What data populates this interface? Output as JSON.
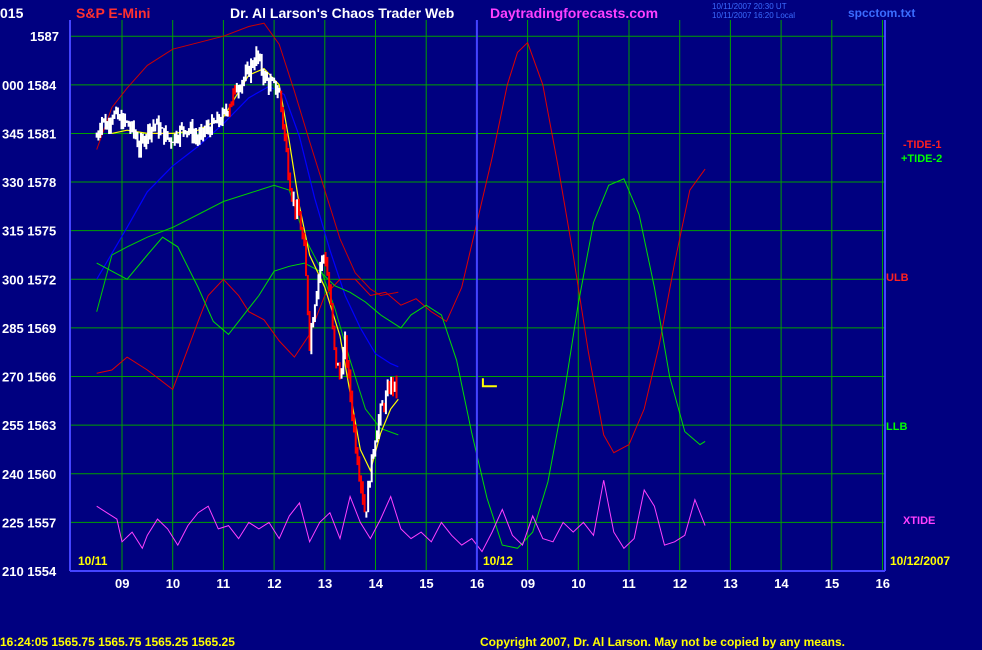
{
  "header": {
    "instrument": "S&P E-Mini",
    "title": "Dr. Al Larson's Chaos Trader Web",
    "site": "Daytradingforecasts.com",
    "stamp1": "10/11/2007 20:30 UT",
    "stamp2": "10/11/2007 16:20 Local",
    "file": "spcctom.txt"
  },
  "footer": {
    "quote": "16:24:05  1565.75  1565.75  1565.25  1565.25",
    "copyright": "Copyright 2007, Dr. Al Larson. May not be copied by any means."
  },
  "colors": {
    "background": "#000080",
    "grid": "#00a000",
    "price_bar": "#ffffff",
    "price_bar_down": "#ff0000",
    "tide1": "#e00000",
    "tide2": "#00dd00",
    "ulb": "#cc0000",
    "llb": "#00cc00",
    "xtide": "#ff40ff",
    "ma": "#ffff00",
    "ma_slow": "#0000ff",
    "now_line": "#4444ff"
  },
  "chart_data": {
    "type": "line",
    "title": "Dr. Al Larson's Chaos Trader Web",
    "y_left_labels": [
      "015",
      "000",
      "345",
      "330",
      "315",
      "300",
      "285",
      "270",
      "255",
      "240",
      "225",
      "210"
    ],
    "y_prices": [
      1587,
      1584,
      1581,
      1578,
      1575,
      1572,
      1569,
      1566,
      1563,
      1560,
      1557,
      1554
    ],
    "ylim": [
      1554,
      1588
    ],
    "x_hour_labels": [
      "09",
      "10",
      "11",
      "12",
      "13",
      "14",
      "15",
      "16",
      "09",
      "10",
      "11",
      "12",
      "13",
      "14",
      "15",
      "16"
    ],
    "x_date_labels": [
      "10/11",
      "10/12",
      "10/12/2007"
    ],
    "series_labels": [
      "-TIDE-1",
      "+TIDE-2",
      "ULB",
      "LLB",
      "XTIDE"
    ],
    "marker_label": "L",
    "price_close": [
      [
        0.0,
        1580.8
      ],
      [
        0.1,
        1582.0
      ],
      [
        0.2,
        1581.4
      ],
      [
        0.3,
        1582.3
      ],
      [
        0.45,
        1581.8
      ],
      [
        0.6,
        1581.6
      ],
      [
        0.75,
        1581.0
      ],
      [
        0.85,
        1580.0
      ],
      [
        0.95,
        1580.8
      ],
      [
        1.0,
        1581.2
      ],
      [
        1.15,
        1581.6
      ],
      [
        1.3,
        1581.0
      ],
      [
        1.45,
        1580.6
      ],
      [
        1.6,
        1581.0
      ],
      [
        1.75,
        1581.4
      ],
      [
        1.9,
        1581.0
      ],
      [
        2.0,
        1580.6
      ],
      [
        2.15,
        1581.2
      ],
      [
        2.3,
        1581.5
      ],
      [
        2.5,
        1582.0
      ],
      [
        2.7,
        1583.4
      ],
      [
        2.85,
        1584.3
      ],
      [
        2.95,
        1584.5
      ],
      [
        3.05,
        1585.2
      ],
      [
        3.15,
        1585.8
      ],
      [
        3.25,
        1585.0
      ],
      [
        3.35,
        1584.2
      ],
      [
        3.45,
        1584.0
      ],
      [
        3.6,
        1583.6
      ],
      [
        3.7,
        1581.0
      ],
      [
        3.8,
        1578.2
      ],
      [
        3.9,
        1576.5
      ],
      [
        4.0,
        1575.8
      ],
      [
        4.1,
        1573.6
      ],
      [
        4.15,
        1571.0
      ],
      [
        4.2,
        1568.2
      ],
      [
        4.3,
        1570.6
      ],
      [
        4.4,
        1572.8
      ],
      [
        4.5,
        1573.6
      ],
      [
        4.6,
        1571.0
      ],
      [
        4.7,
        1567.2
      ],
      [
        4.8,
        1566.0
      ],
      [
        4.9,
        1568.0
      ],
      [
        5.0,
        1565.0
      ],
      [
        5.1,
        1562.0
      ],
      [
        5.2,
        1559.8
      ],
      [
        5.3,
        1557.4
      ],
      [
        5.4,
        1560.2
      ],
      [
        5.5,
        1562.4
      ],
      [
        5.6,
        1563.8
      ],
      [
        5.7,
        1564.6
      ],
      [
        5.8,
        1565.6
      ],
      [
        5.9,
        1565.2
      ],
      [
        5.95,
        1565.4
      ]
    ],
    "ma_fast": [
      [
        0.3,
        1581.0
      ],
      [
        0.6,
        1581.2
      ],
      [
        1.0,
        1581.0
      ],
      [
        1.5,
        1581.0
      ],
      [
        2.0,
        1581.2
      ],
      [
        2.5,
        1582.0
      ],
      [
        3.0,
        1584.6
      ],
      [
        3.3,
        1585.0
      ],
      [
        3.6,
        1584.0
      ],
      [
        3.8,
        1580.5
      ],
      [
        4.0,
        1576.5
      ],
      [
        4.2,
        1573.5
      ],
      [
        4.5,
        1571.5
      ],
      [
        4.8,
        1568.5
      ],
      [
        5.0,
        1565.0
      ],
      [
        5.2,
        1561.5
      ],
      [
        5.4,
        1560.2
      ],
      [
        5.6,
        1562.5
      ],
      [
        5.8,
        1564.0
      ],
      [
        5.95,
        1564.6
      ]
    ],
    "ma_slow": [
      [
        0.0,
        1572.0
      ],
      [
        0.3,
        1573.6
      ],
      [
        0.6,
        1575.2
      ],
      [
        1.0,
        1577.4
      ],
      [
        1.5,
        1579.0
      ],
      [
        2.0,
        1580.2
      ],
      [
        2.5,
        1581.6
      ],
      [
        3.0,
        1583.2
      ],
      [
        3.4,
        1583.9
      ],
      [
        3.7,
        1583.4
      ],
      [
        4.0,
        1580.8
      ],
      [
        4.3,
        1577.0
      ],
      [
        4.6,
        1573.8
      ],
      [
        4.9,
        1571.0
      ],
      [
        5.2,
        1569.0
      ],
      [
        5.5,
        1567.4
      ],
      [
        5.8,
        1566.8
      ],
      [
        5.95,
        1566.6
      ]
    ],
    "llb": [
      [
        0.0,
        1570.0
      ],
      [
        0.3,
        1573.5
      ],
      [
        0.6,
        1574.0
      ],
      [
        1.0,
        1574.6
      ],
      [
        1.5,
        1575.2
      ],
      [
        2.0,
        1576.0
      ],
      [
        2.5,
        1576.8
      ],
      [
        3.0,
        1577.3
      ],
      [
        3.3,
        1577.6
      ],
      [
        3.5,
        1577.8
      ],
      [
        3.8,
        1577.5
      ],
      [
        4.1,
        1574.6
      ],
      [
        4.4,
        1572.8
      ],
      [
        4.7,
        1570.2
      ],
      [
        5.0,
        1567.0
      ],
      [
        5.3,
        1564.0
      ],
      [
        5.6,
        1562.8
      ],
      [
        5.95,
        1562.4
      ]
    ],
    "ulb": [
      [
        0.0,
        1580.0
      ],
      [
        0.3,
        1582.6
      ],
      [
        0.6,
        1583.8
      ],
      [
        1.0,
        1585.2
      ],
      [
        1.5,
        1586.2
      ],
      [
        2.0,
        1586.6
      ],
      [
        2.5,
        1587.0
      ],
      [
        3.0,
        1587.6
      ],
      [
        3.3,
        1587.8
      ],
      [
        3.6,
        1586.5
      ],
      [
        3.9,
        1583.6
      ],
      [
        4.2,
        1580.5
      ],
      [
        4.5,
        1577.5
      ],
      [
        4.8,
        1574.5
      ],
      [
        5.1,
        1572.4
      ],
      [
        5.4,
        1571.4
      ],
      [
        5.6,
        1571.0
      ],
      [
        5.95,
        1571.2
      ]
    ],
    "tide1": [
      [
        0.0,
        1566.2
      ],
      [
        0.3,
        1566.4
      ],
      [
        0.6,
        1567.2
      ],
      [
        1.0,
        1566.4
      ],
      [
        1.5,
        1565.2
      ],
      [
        2.0,
        1569.4
      ],
      [
        2.2,
        1571.0
      ],
      [
        2.5,
        1572.0
      ],
      [
        2.8,
        1571.0
      ],
      [
        3.0,
        1570.0
      ],
      [
        3.3,
        1569.5
      ],
      [
        3.6,
        1568.2
      ],
      [
        3.9,
        1567.2
      ],
      [
        4.2,
        1568.6
      ],
      [
        4.5,
        1571.0
      ],
      [
        4.8,
        1572.0
      ],
      [
        5.1,
        1572.0
      ],
      [
        5.4,
        1571.0
      ],
      [
        5.7,
        1571.2
      ],
      [
        6.0,
        1570.4
      ],
      [
        6.3,
        1570.8
      ],
      [
        6.6,
        1570.0
      ],
      [
        6.9,
        1569.4
      ],
      [
        7.2,
        1571.5
      ],
      [
        7.5,
        1575.5
      ],
      [
        7.8,
        1579.5
      ],
      [
        8.1,
        1584.0
      ],
      [
        8.3,
        1586.0
      ],
      [
        8.5,
        1586.6
      ],
      [
        8.8,
        1584.0
      ],
      [
        9.1,
        1579.0
      ],
      [
        9.4,
        1573.5
      ],
      [
        9.7,
        1567.5
      ],
      [
        10.0,
        1562.4
      ],
      [
        10.2,
        1561.3
      ],
      [
        10.5,
        1561.8
      ],
      [
        10.8,
        1564.0
      ],
      [
        11.1,
        1568.0
      ],
      [
        11.4,
        1573.0
      ],
      [
        11.7,
        1577.5
      ],
      [
        12.0,
        1578.8
      ]
    ],
    "tide2": [
      [
        0.0,
        1573.0
      ],
      [
        0.3,
        1572.5
      ],
      [
        0.6,
        1572.0
      ],
      [
        1.0,
        1573.5
      ],
      [
        1.3,
        1574.6
      ],
      [
        1.6,
        1574.0
      ],
      [
        2.0,
        1571.5
      ],
      [
        2.3,
        1569.4
      ],
      [
        2.6,
        1568.6
      ],
      [
        2.9,
        1569.8
      ],
      [
        3.2,
        1571.0
      ],
      [
        3.5,
        1572.5
      ],
      [
        3.8,
        1572.8
      ],
      [
        4.1,
        1573.0
      ],
      [
        4.4,
        1572.5
      ],
      [
        4.7,
        1571.6
      ],
      [
        5.0,
        1571.2
      ],
      [
        5.3,
        1570.6
      ],
      [
        5.6,
        1569.8
      ],
      [
        5.9,
        1569.2
      ],
      [
        6.0,
        1569.0
      ],
      [
        6.2,
        1569.8
      ],
      [
        6.5,
        1570.4
      ],
      [
        6.8,
        1569.8
      ],
      [
        7.1,
        1567.0
      ],
      [
        7.4,
        1562.5
      ],
      [
        7.7,
        1558.5
      ],
      [
        8.0,
        1555.6
      ],
      [
        8.3,
        1555.4
      ],
      [
        8.6,
        1556.4
      ],
      [
        8.9,
        1559.5
      ],
      [
        9.2,
        1564.5
      ],
      [
        9.5,
        1570.5
      ],
      [
        9.8,
        1575.5
      ],
      [
        10.1,
        1577.8
      ],
      [
        10.4,
        1578.2
      ],
      [
        10.7,
        1576.0
      ],
      [
        11.0,
        1571.5
      ],
      [
        11.3,
        1566.0
      ],
      [
        11.6,
        1562.6
      ],
      [
        11.9,
        1561.8
      ],
      [
        12.0,
        1562.0
      ]
    ],
    "xtide": [
      [
        0.0,
        1558.0
      ],
      [
        0.2,
        1557.6
      ],
      [
        0.4,
        1557.2
      ],
      [
        0.5,
        1555.8
      ],
      [
        0.7,
        1556.4
      ],
      [
        0.9,
        1555.4
      ],
      [
        1.0,
        1556.2
      ],
      [
        1.2,
        1557.2
      ],
      [
        1.4,
        1556.6
      ],
      [
        1.6,
        1555.6
      ],
      [
        1.8,
        1556.8
      ],
      [
        2.0,
        1557.6
      ],
      [
        2.2,
        1558.0
      ],
      [
        2.4,
        1556.6
      ],
      [
        2.6,
        1556.8
      ],
      [
        2.8,
        1556.0
      ],
      [
        3.0,
        1557.0
      ],
      [
        3.2,
        1556.6
      ],
      [
        3.4,
        1557.0
      ],
      [
        3.6,
        1556.0
      ],
      [
        3.8,
        1557.4
      ],
      [
        4.0,
        1558.2
      ],
      [
        4.2,
        1555.8
      ],
      [
        4.4,
        1557.0
      ],
      [
        4.6,
        1557.6
      ],
      [
        4.8,
        1556.0
      ],
      [
        5.0,
        1558.6
      ],
      [
        5.2,
        1557.0
      ],
      [
        5.4,
        1556.0
      ],
      [
        5.6,
        1557.2
      ],
      [
        5.8,
        1558.6
      ],
      [
        6.0,
        1556.6
      ],
      [
        6.2,
        1556.0
      ],
      [
        6.4,
        1556.4
      ],
      [
        6.6,
        1555.8
      ],
      [
        6.8,
        1557.0
      ],
      [
        7.0,
        1556.2
      ],
      [
        7.2,
        1555.6
      ],
      [
        7.4,
        1556.0
      ],
      [
        7.6,
        1555.2
      ],
      [
        7.8,
        1556.4
      ],
      [
        8.0,
        1557.8
      ],
      [
        8.2,
        1556.2
      ],
      [
        8.4,
        1555.6
      ],
      [
        8.6,
        1557.4
      ],
      [
        8.8,
        1556.0
      ],
      [
        9.0,
        1555.8
      ],
      [
        9.2,
        1557.0
      ],
      [
        9.4,
        1556.4
      ],
      [
        9.6,
        1557.0
      ],
      [
        9.8,
        1556.2
      ],
      [
        10.0,
        1559.6
      ],
      [
        10.2,
        1556.4
      ],
      [
        10.4,
        1555.4
      ],
      [
        10.6,
        1556.0
      ],
      [
        10.8,
        1559.0
      ],
      [
        11.0,
        1558.0
      ],
      [
        11.2,
        1555.6
      ],
      [
        11.4,
        1555.8
      ],
      [
        11.6,
        1556.2
      ],
      [
        11.8,
        1558.4
      ],
      [
        12.0,
        1556.8
      ]
    ]
  }
}
